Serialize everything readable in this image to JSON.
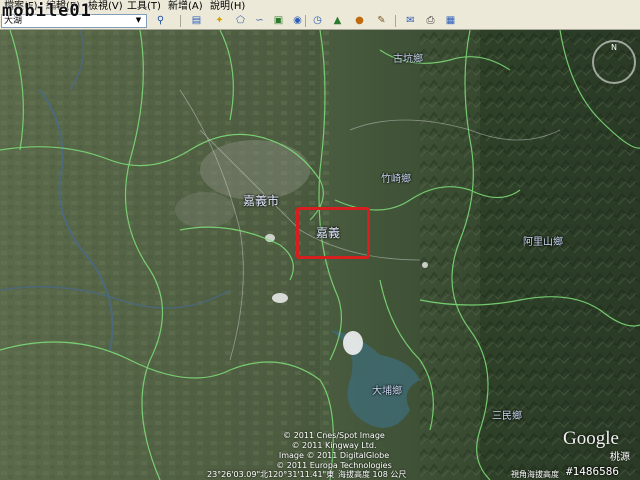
{
  "watermark": "mobile01",
  "menu": {
    "items": [
      "檔案(F)",
      "編輯(E)",
      "檢視(V)",
      "工具(T)",
      "新增(A)",
      "說明(H)"
    ]
  },
  "toolbar": {
    "search_value": "大湖",
    "buttons": [
      {
        "icon": "search-icon"
      },
      {
        "icon": "sidebar-icon"
      },
      {
        "icon": "placemark-icon"
      },
      {
        "icon": "polygon-icon"
      },
      {
        "icon": "path-icon"
      },
      {
        "icon": "overlay-icon"
      },
      {
        "icon": "record-tour-icon"
      },
      {
        "icon": "historical-imagery-icon"
      },
      {
        "icon": "sunlight-icon"
      },
      {
        "icon": "planet-icon"
      },
      {
        "icon": "ruler-icon"
      },
      {
        "icon": "email-icon"
      },
      {
        "icon": "print-icon"
      },
      {
        "icon": "maps-icon"
      }
    ]
  },
  "map": {
    "labels": {
      "gukeng": "古坑鄉",
      "zhuqi": "竹崎鄉",
      "chiayi_city": "嘉義市",
      "chiayi": "嘉義",
      "alishan": "阿里山鄉",
      "dapu": "大埔鄉",
      "sanmin": "三民鄉"
    },
    "copyright": [
      "© 2011 Cnes/Spot Image",
      "© 2011 Kingway Ltd.",
      "Image © 2011 DigitalGlobe",
      "© 2011 Europa Technologies"
    ],
    "google_logo": "Google",
    "corner_label": "桃源",
    "status": {
      "lat": "23°26'03.09\"北",
      "lon": "120°31'11.41\"東",
      "elevation": "海拔高度 108 公尺",
      "eye_alt": "視角海拔高度"
    },
    "post_id": "#1486586"
  }
}
